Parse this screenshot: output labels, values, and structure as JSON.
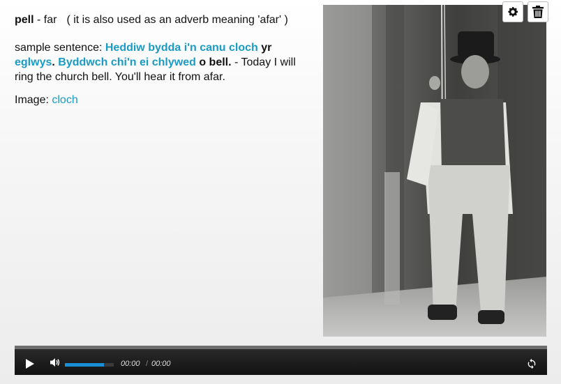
{
  "entry": {
    "word": "pell",
    "dash": " - far",
    "note": "( it is also used as an adverb meaning 'afar' )"
  },
  "sample": {
    "label": "sample sentence: ",
    "seg1_link": "Heddiw bydda i'n canu cloch",
    "seg1_bold": " yr",
    "seg2_link": "eglwys",
    "seg2_bold": ".",
    "seg3_link": " Byddwch chi'n ei chlywed",
    "seg3_bold": " o bell.",
    "translation": " - Today I will ring the church bell. You'll hear it from afar."
  },
  "image": {
    "label": "Image: ",
    "link": "cloch"
  },
  "toolbar": {
    "settings_icon": "gear-icon",
    "delete_icon": "trash-icon"
  },
  "player": {
    "current_time": "00:00",
    "separator": "/",
    "duration": "00:00",
    "volume_level": 0.8,
    "accent_color": "#1a8fd6"
  },
  "colors": {
    "link": "#1a9bc4"
  }
}
